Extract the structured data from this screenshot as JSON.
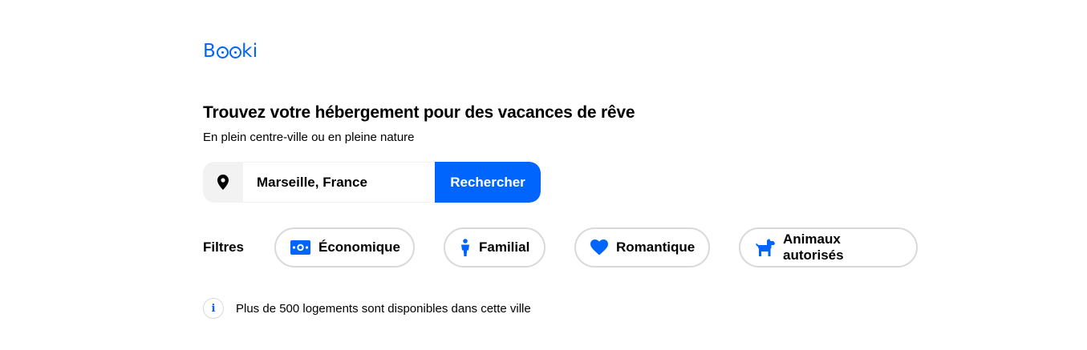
{
  "brand": {
    "logo_text_left": "B",
    "logo_text_right": "ki",
    "accent_color": "#0065FC"
  },
  "hero": {
    "title": "Trouvez votre hébergement pour des vacances de rêve",
    "subtitle": "En plein centre-ville ou en pleine nature"
  },
  "search": {
    "location_icon": "map-pin-icon",
    "value": "Marseille, France",
    "button_label": "Rechercher"
  },
  "filters": {
    "label": "Filtres",
    "items": [
      {
        "label": "Économique",
        "icon": "money-icon"
      },
      {
        "label": "Familial",
        "icon": "person-icon"
      },
      {
        "label": "Romantique",
        "icon": "heart-icon"
      },
      {
        "label": "Animaux autorisés",
        "icon": "dog-icon"
      }
    ]
  },
  "info": {
    "icon": "info-icon",
    "icon_glyph": "i",
    "text": "Plus de 500 logements sont disponibles dans cette ville"
  }
}
